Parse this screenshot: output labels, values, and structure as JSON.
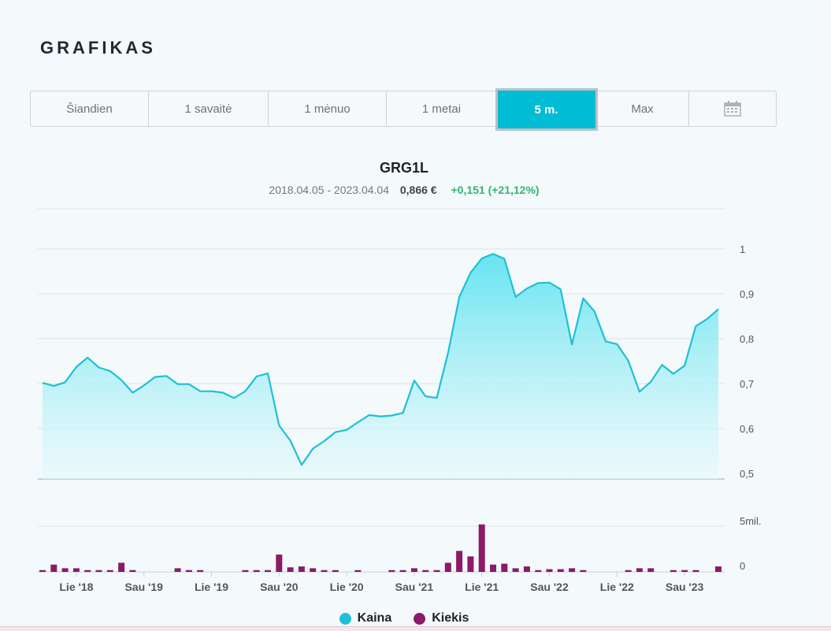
{
  "title": "GRAFIKAS",
  "range_buttons": [
    "Šiandien",
    "1 savaitė",
    "1 mėnuo",
    "1 metai",
    "5 m.",
    "Max"
  ],
  "active_range": "5 m.",
  "calendar_icon": "calendar-icon",
  "ticker": "GRG1L",
  "date_range": "2018.04.05 - 2023.04.04",
  "last_price": "0,866 €",
  "change": "+0,151 (+21,12%)",
  "colors": {
    "accent": "#00bcd4",
    "price_line": "#1ec0d6",
    "volume": "#8b1a6b",
    "positive": "#2eb872"
  },
  "legend": [
    {
      "label": "Kaina",
      "color": "#1ec0d6"
    },
    {
      "label": "Kiekis",
      "color": "#8b1a6b"
    }
  ],
  "chart_data": {
    "type": "area",
    "price_axis": {
      "ticks": [
        "0,5",
        "0,6",
        "0,7",
        "0,8",
        "0,9",
        "1"
      ],
      "ylim": [
        0.5,
        1.05
      ]
    },
    "volume_axis": {
      "ticks": [
        "0",
        "5mil."
      ],
      "ylim": [
        0,
        6000000
      ]
    },
    "x_ticks": [
      "Lie '18",
      "Sau '19",
      "Lie '19",
      "Sau '20",
      "Lie '20",
      "Sau '21",
      "Lie '21",
      "Sau '22",
      "Lie '22",
      "Sau '23"
    ],
    "x_tick_positions": [
      0.05,
      0.15,
      0.25,
      0.35,
      0.45,
      0.55,
      0.65,
      0.75,
      0.85,
      0.95
    ],
    "series": [
      {
        "name": "Kaina",
        "values": [
          0.702,
          0.695,
          0.703,
          0.737,
          0.758,
          0.736,
          0.728,
          0.708,
          0.68,
          0.696,
          0.715,
          0.717,
          0.699,
          0.699,
          0.683,
          0.683,
          0.68,
          0.668,
          0.683,
          0.716,
          0.723,
          0.607,
          0.573,
          0.519,
          0.555,
          0.572,
          0.592,
          0.597,
          0.614,
          0.63,
          0.627,
          0.629,
          0.635,
          0.707,
          0.672,
          0.668,
          0.768,
          0.893,
          0.947,
          0.979,
          0.989,
          0.978,
          0.893,
          0.912,
          0.924,
          0.925,
          0.91,
          0.787,
          0.89,
          0.861,
          0.794,
          0.788,
          0.751,
          0.682,
          0.704,
          0.742,
          0.722,
          0.74,
          0.828,
          0.844,
          0.866
        ]
      },
      {
        "name": "Kiekis",
        "values": [
          200000,
          800000,
          400000,
          400000,
          200000,
          200000,
          200000,
          1000000,
          200000,
          0,
          0,
          0,
          400000,
          200000,
          200000,
          0,
          0,
          0,
          200000,
          200000,
          200000,
          1900000,
          500000,
          600000,
          400000,
          200000,
          200000,
          0,
          200000,
          0,
          0,
          200000,
          200000,
          400000,
          200000,
          200000,
          1000000,
          2300000,
          1700000,
          5200000,
          800000,
          900000,
          400000,
          600000,
          200000,
          300000,
          300000,
          400000,
          200000,
          0,
          0,
          0,
          200000,
          400000,
          400000,
          0,
          200000,
          200000,
          200000,
          0,
          600000
        ]
      }
    ]
  }
}
